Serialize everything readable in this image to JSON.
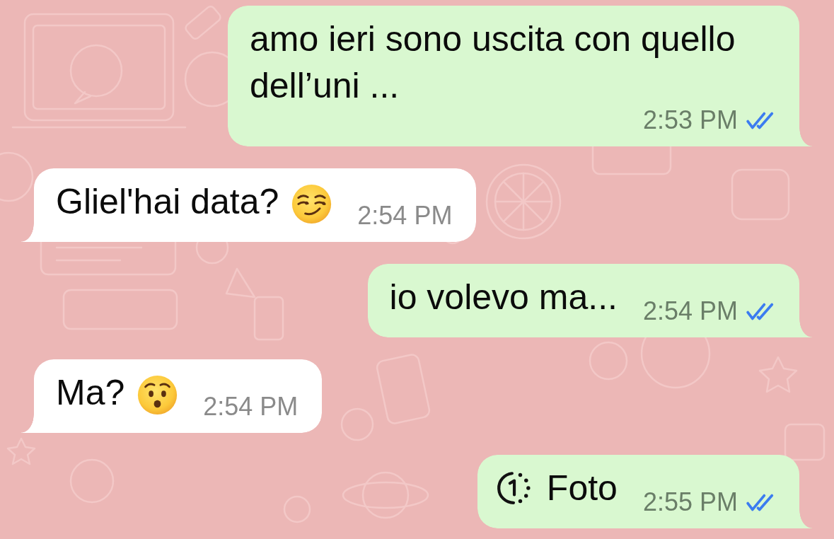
{
  "messages": [
    {
      "outgoing": true,
      "parts": [
        {
          "kind": "text",
          "text": "amo ieri sono uscita con quello dell’uni ..."
        }
      ],
      "time": "2:53 PM",
      "read": true
    },
    {
      "outgoing": false,
      "parts": [
        {
          "kind": "text",
          "text": "Gliel'hai data?"
        },
        {
          "kind": "smirk_emoji"
        }
      ],
      "time": "2:54 PM"
    },
    {
      "outgoing": true,
      "parts": [
        {
          "kind": "text",
          "text": "io volevo ma..."
        }
      ],
      "time": "2:54 PM",
      "read": true
    },
    {
      "outgoing": false,
      "parts": [
        {
          "kind": "text",
          "text": "Ma?"
        },
        {
          "kind": "hushed_emoji"
        }
      ],
      "time": "2:54 PM"
    },
    {
      "outgoing": true,
      "parts": [
        {
          "kind": "view_once_icon"
        },
        {
          "kind": "text",
          "text": "Foto"
        }
      ],
      "time": "2:55 PM",
      "read": true
    }
  ]
}
